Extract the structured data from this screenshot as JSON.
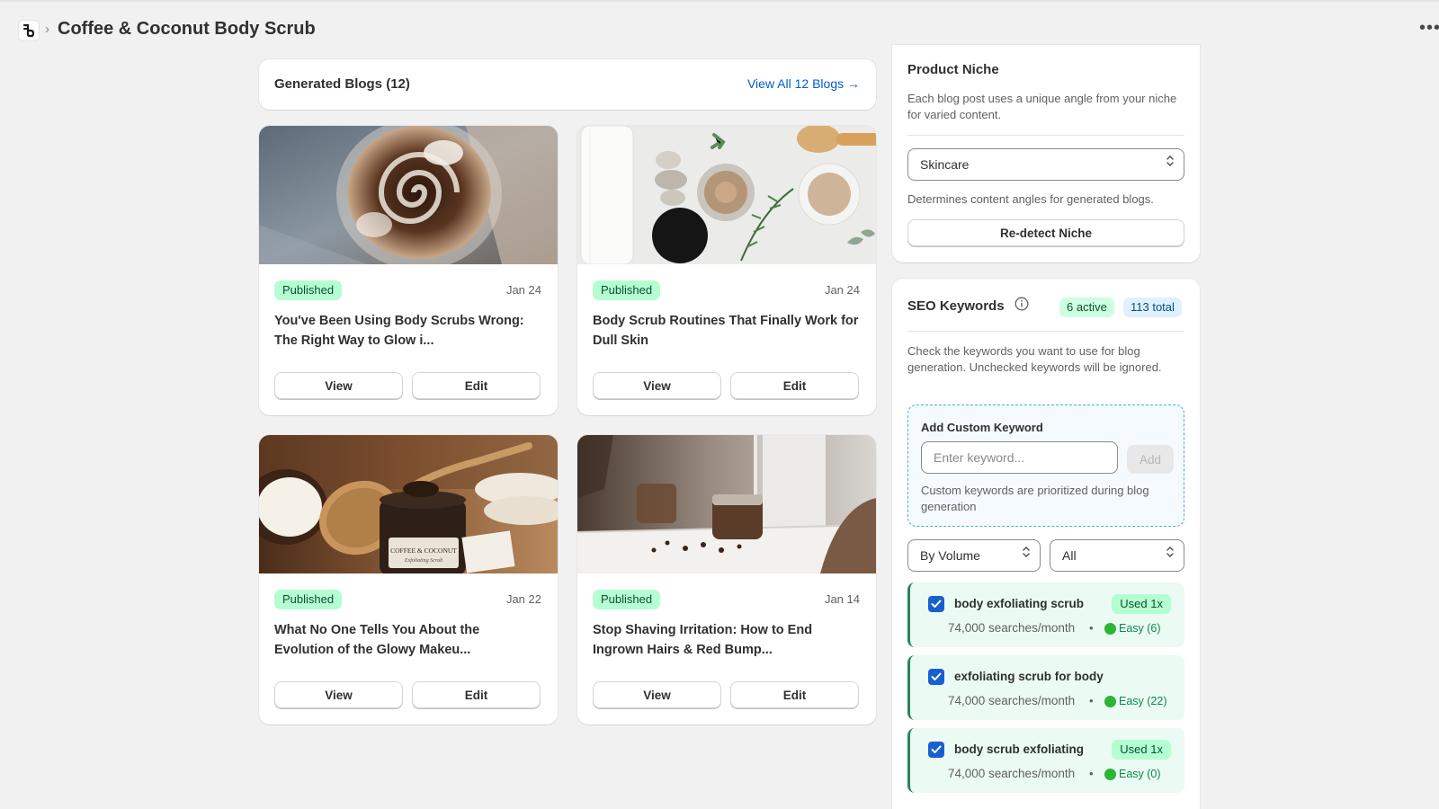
{
  "header": {
    "title": "Coffee & Coconut Body Scrub",
    "breadcrumb_sep": "›",
    "more_label": "•••"
  },
  "blogs": {
    "title": "Generated Blogs (12)",
    "view_all": "View All 12 Blogs →",
    "items": [
      {
        "status": "Published",
        "date": "Jan 24",
        "title": "You've Been Using Body Scrubs Wrong: The Right Way to Glow i...",
        "view_label": "View",
        "edit_label": "Edit"
      },
      {
        "status": "Published",
        "date": "Jan 24",
        "title": "Body Scrub Routines That Finally Work for Dull Skin",
        "view_label": "View",
        "edit_label": "Edit"
      },
      {
        "status": "Published",
        "date": "Jan 22",
        "title": "What No One Tells You About the Evolution of the Glowy Makeu...",
        "view_label": "View",
        "edit_label": "Edit"
      },
      {
        "status": "Published",
        "date": "Jan 14",
        "title": "Stop Shaving Irritation: How to End Ingrown Hairs & Red Bump...",
        "view_label": "View",
        "edit_label": "Edit"
      }
    ],
    "jar_label_line1": "COFFEE & COCONUT",
    "jar_label_line2": "Exfoliating Scrub"
  },
  "niche": {
    "title": "Product Niche",
    "description": "Each blog post uses a unique angle from your niche for varied content.",
    "selected": "Skincare",
    "hint": "Determines content angles for generated blogs.",
    "redetect_label": "Re-detect Niche"
  },
  "seo": {
    "title": "SEO Keywords",
    "active_badge": "6 active",
    "total_badge": "113 total",
    "description": "Check the keywords you want to use for blog generation. Unchecked keywords will be ignored.",
    "custom": {
      "title": "Add Custom Keyword",
      "placeholder": "Enter keyword...",
      "add_label": "Add",
      "note": "Custom keywords are prioritized during blog generation"
    },
    "sort_selected": "By Volume",
    "filter_selected": "All",
    "keywords": [
      {
        "name": "body exfoliating scrub",
        "used": "Used 1x",
        "volume": "74,000 searches/month",
        "difficulty": "Easy (6)"
      },
      {
        "name": "exfoliating scrub for body",
        "used": "",
        "volume": "74,000 searches/month",
        "difficulty": "Easy (22)"
      },
      {
        "name": "body scrub exfoliating",
        "used": "Used 1x",
        "volume": "74,000 searches/month",
        "difficulty": "Easy (0)"
      }
    ],
    "separator": "•"
  },
  "colors": {
    "accent_link": "#005bd3",
    "published_bg": "#b4fed2",
    "checkbox": "#1a5fd0",
    "easy_dot": "#2bb533"
  }
}
